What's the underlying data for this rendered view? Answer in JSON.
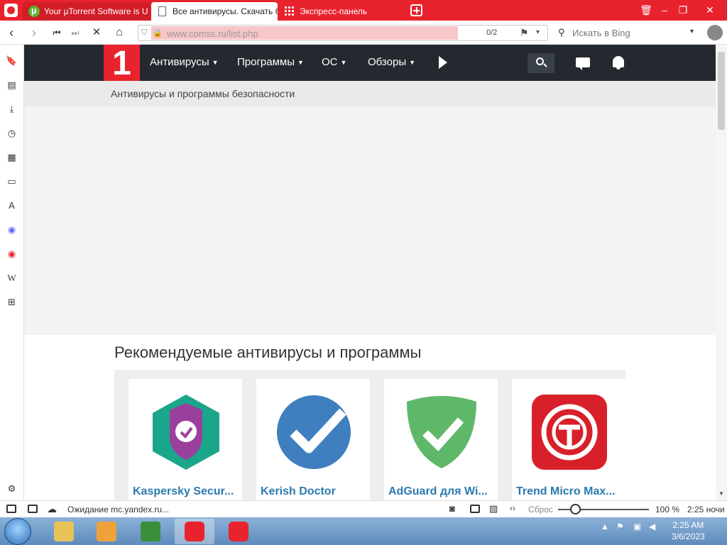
{
  "tabs": [
    {
      "label": "Your µTorrent Software is U",
      "icon": "utorrent-icon"
    },
    {
      "label": "Все антивирусы. Скачать б",
      "icon": "document-icon"
    },
    {
      "label": "Экспресс-панель",
      "icon": "grid-icon"
    }
  ],
  "address": {
    "url": "www.comss.ru/list.php",
    "match_count": "0/2",
    "search_placeholder": "Искать в Bing",
    "load_progress": 0.8
  },
  "site": {
    "logo": "1",
    "nav": [
      "Антивирусы",
      "Программы",
      "ОС",
      "Обзоры"
    ],
    "breadcrumb": "Антивирусы и программы безопасности"
  },
  "content": {
    "section_title": "Рекомендуемые антивирусы и программы",
    "cards": [
      {
        "name": "Kaspersky Secur...",
        "logo": "kaspersky-logo",
        "color": "#1aa68a"
      },
      {
        "name": "Kerish Doctor",
        "logo": "kerish-doctor-logo",
        "color": "#3f7fbf"
      },
      {
        "name": "AdGuard для Wi...",
        "logo": "adguard-logo",
        "color": "#5fb869"
      },
      {
        "name": "Trend Micro Max...",
        "logo": "trend-micro-logo",
        "color": "#d8202a"
      }
    ]
  },
  "statusbar": {
    "status_text": "Ожидание mc.yandex.ru...",
    "reset_label": "Сброс",
    "zoom": "100 %",
    "time": "2:25 ночи"
  },
  "taskbar": {
    "clock_time": "2:25 AM",
    "clock_date": "3/6/2023"
  },
  "colors": {
    "brand_red": "#e8232e",
    "site_nav": "#24292f",
    "link_blue": "#2a7ab0"
  }
}
